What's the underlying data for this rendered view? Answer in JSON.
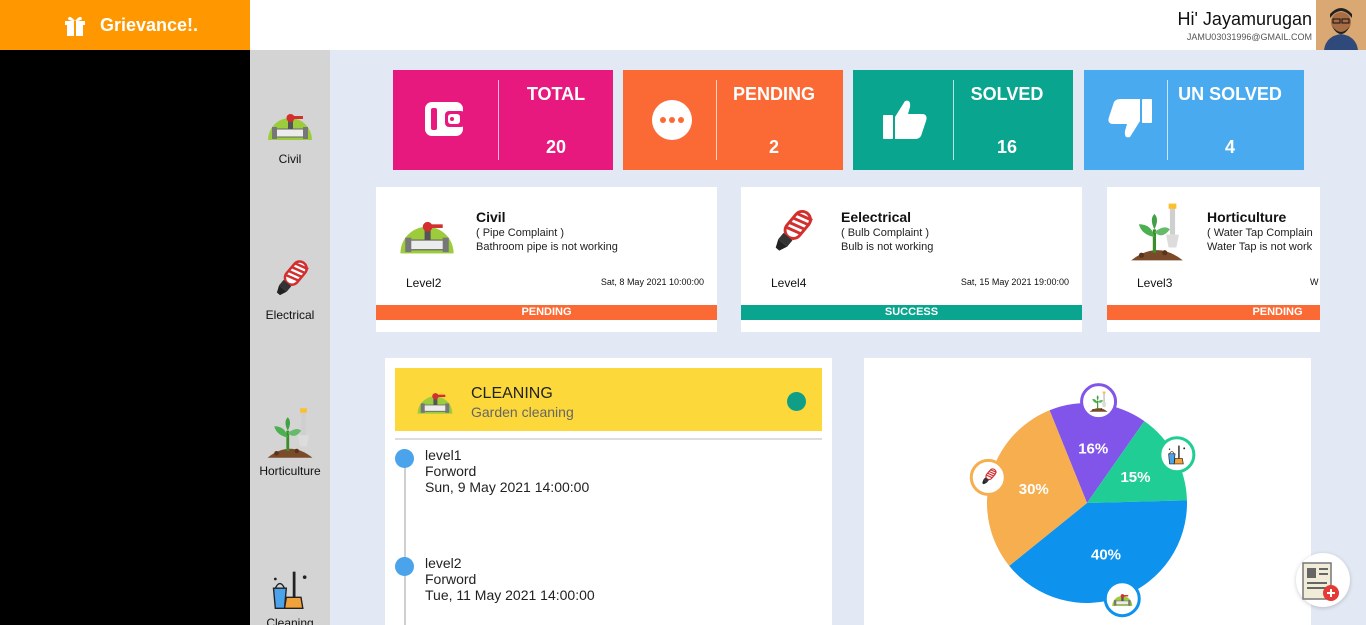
{
  "brand": {
    "name": "Grievance!."
  },
  "user": {
    "greeting": "Hi' Jayamurugan",
    "email": "JAMU03031996@GMAIL.COM"
  },
  "categories": [
    {
      "label": "Civil",
      "icon": "pipe-icon"
    },
    {
      "label": "Electrical",
      "icon": "bulb-icon"
    },
    {
      "label": "Horticulture",
      "icon": "plant-icon"
    },
    {
      "label": "Cleaning",
      "icon": "cleaning-icon"
    }
  ],
  "stats": [
    {
      "label": "TOTAL",
      "value": "20",
      "color": "#e8197e",
      "icon": "wallet-icon"
    },
    {
      "label": "PENDING",
      "value": "2",
      "color": "#fb6a35",
      "icon": "more-icon"
    },
    {
      "label": "SOLVED",
      "value": "16",
      "color": "#0aa58f",
      "icon": "thumbs-up-icon"
    },
    {
      "label": "UN SOLVED",
      "value": "4",
      "color": "#4aaaf0",
      "icon": "thumbs-down-icon"
    }
  ],
  "complaints": [
    {
      "title": "Civil",
      "subtitle": "( Pipe Complaint )",
      "description": "Bathroom pipe is not working",
      "level": "Level2",
      "date": "Sat, 8 May 2021 10:00:00",
      "status": "PENDING",
      "status_color": "#fb6a35"
    },
    {
      "title": "Eelectrical",
      "subtitle": "( Bulb Complaint )",
      "description": "Bulb is not working",
      "level": "Level4",
      "date": "Sat, 15 May 2021 19:00:00",
      "status": "SUCCESS",
      "status_color": "#0aa58f"
    },
    {
      "title": "Horticulture",
      "subtitle": "( Water Tap Complain",
      "description": "Water Tap is not work",
      "level": "Level3",
      "date": "W",
      "status": "PENDING",
      "status_color": "#fb6a35"
    }
  ],
  "timeline": {
    "title": "CLEANING",
    "subtitle": "Garden cleaning",
    "items": [
      {
        "level": "level1",
        "action": "Forword",
        "date": "Sun, 9 May 2021 14:00:00"
      },
      {
        "level": "level2",
        "action": "Forword",
        "date": "Tue, 11 May 2021 14:00:00"
      }
    ]
  },
  "chart_data": {
    "type": "pie",
    "slices": [
      {
        "label": "16%",
        "value": 16,
        "color": "#8155ea",
        "icon": "plant-icon"
      },
      {
        "label": "15%",
        "value": 15,
        "color": "#20cd94",
        "icon": "cleaning-icon"
      },
      {
        "label": "40%",
        "value": 40,
        "color": "#0d93ee",
        "icon": "pipe-icon"
      },
      {
        "label": "30%",
        "value": 30,
        "color": "#f6ae4e",
        "icon": "bulb-icon"
      }
    ]
  }
}
